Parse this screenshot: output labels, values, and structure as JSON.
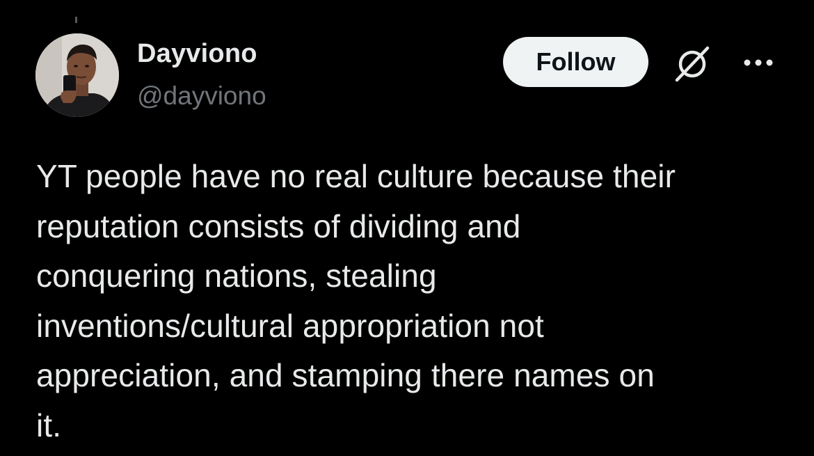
{
  "tweet": {
    "author": {
      "display_name": "Dayviono",
      "handle": "@dayviono",
      "avatar_icon": "profile-photo-avatar"
    },
    "actions": {
      "follow_label": "Follow",
      "grok_icon": "grok-icon",
      "more_icon": "more-options-icon"
    },
    "text_lines": [
      "YT people have no real culture because their",
      "reputation consists of dividing and",
      "conquering nations, stealing",
      "inventions/cultural appropriation not",
      "appreciation, and stamping there names on",
      "it."
    ]
  },
  "colors": {
    "background": "#000000",
    "primary_text": "#e7e9ea",
    "secondary_text": "#71767b",
    "follow_button_bg": "#eff3f4",
    "follow_button_text": "#0f1419"
  }
}
